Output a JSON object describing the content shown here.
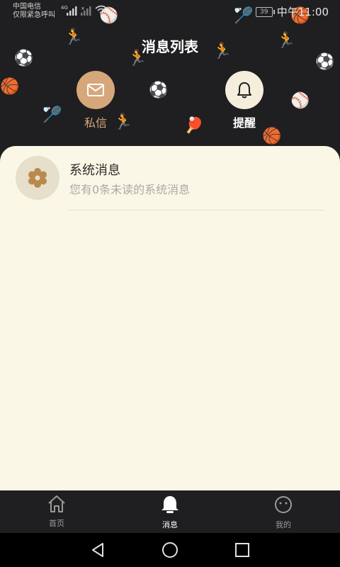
{
  "status_bar": {
    "carrier_line1": "中国电信",
    "carrier_line2": "仅限紧急呼叫",
    "network": "4G",
    "battery": "39",
    "time": "中午11:00"
  },
  "header": {
    "title": "消息列表"
  },
  "top_tabs": [
    {
      "label": "私信",
      "icon": "mail-icon",
      "color": "#d5a77a"
    },
    {
      "label": "提醒",
      "icon": "bell-icon",
      "color": "#f5eedc"
    }
  ],
  "messages": [
    {
      "title": "系统消息",
      "subtitle": "您有0条未读的系统消息",
      "icon": "gear-icon"
    }
  ],
  "bottom_tabs": [
    {
      "label": "首页",
      "icon": "home-icon"
    },
    {
      "label": "消息",
      "icon": "bell-icon"
    },
    {
      "label": "我的",
      "icon": "smile-icon"
    }
  ],
  "colors": {
    "background_dark": "#1f1f21",
    "panel": "#fbf7e6",
    "accent": "#d5a77a"
  }
}
